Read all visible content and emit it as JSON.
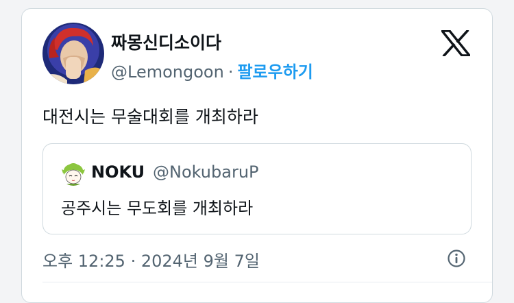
{
  "tweet": {
    "display_name": "짜몽신디소이다",
    "handle": "@Lemongoon",
    "separator": "·",
    "follow_label": "팔로우하기",
    "text": "대전시는 무술대회를 개최하라",
    "timestamp": "오후 12:25 · 2024년 9월 7일"
  },
  "quote": {
    "name": "NOKU",
    "handle": "@NokubaruP",
    "text": "공주시는 무도회를 개최하라"
  },
  "colors": {
    "link": "#1d9bf0",
    "text_primary": "#0f1419",
    "text_secondary": "#536471",
    "border": "#cfd9de"
  },
  "icons": {
    "brand": "x-logo-icon",
    "info": "info-icon"
  }
}
